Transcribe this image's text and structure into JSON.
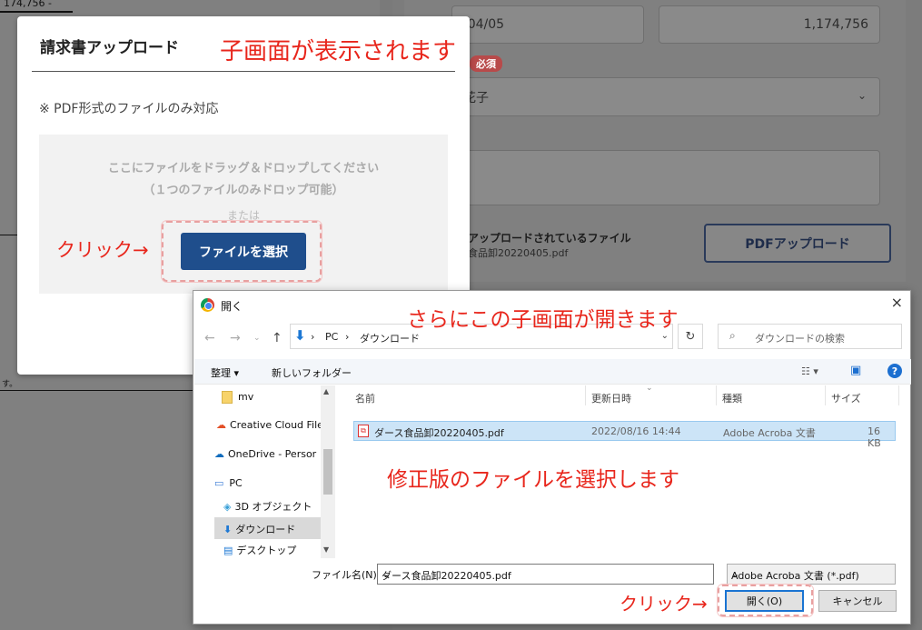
{
  "background": {
    "doc_amount": "174,756 -",
    "doc_snippet": "す。",
    "date_value": "/04/05",
    "amount_value": "1,174,756",
    "required_badge": "必須",
    "name_value": "花子",
    "uploaded_label": "アップロードされているファイル",
    "uploaded_file": "食品卸20220405.pdf",
    "pdf_upload_button": "PDFアップロード"
  },
  "modal": {
    "title": "請求書アップロード",
    "note": "※ PDF形式のファイルのみ対応",
    "drop_line1": "ここにファイルをドラッグ＆ドロップしてください",
    "drop_line2": "（１つのファイルのみドロップ可能）",
    "or_text": "または",
    "select_button": "ファイルを選択"
  },
  "annotations": {
    "child_shown": "子画面が表示されます",
    "click1": "クリック→",
    "dialog_opens": "さらにこの子画面が開きます",
    "select_revised": "修正版のファイルを選択します",
    "click2": "クリック→"
  },
  "dialog": {
    "title": "開く",
    "close": "×",
    "path_pc": "PC",
    "path_folder": "ダウンロード",
    "search_placeholder": "ダウンロードの検索",
    "organize": "整理 ▾",
    "new_folder": "新しいフォルダー",
    "help": "?",
    "tree": [
      {
        "label": "mv",
        "icon": "folder-icon"
      },
      {
        "label": "Creative Cloud File",
        "icon": "creative-cloud-icon"
      },
      {
        "label": "OneDrive - Persor",
        "icon": "onedrive-icon"
      },
      {
        "label": "PC",
        "icon": "pc-icon"
      },
      {
        "label": "3D オブジェクト",
        "icon": "3d-objects-icon"
      },
      {
        "label": "ダウンロード",
        "icon": "download-icon"
      },
      {
        "label": "デスクトップ",
        "icon": "desktop-icon"
      }
    ],
    "columns": {
      "name": "名前",
      "date": "更新日時",
      "type": "種類",
      "size": "サイズ"
    },
    "files": [
      {
        "name": "ダース食品卸20220405.pdf",
        "date": "2022/08/16 14:44",
        "type": "Adobe Acroba 文書",
        "size": "16 KB"
      }
    ],
    "filename_label": "ファイル名(N):",
    "filename_value": "ダース食品卸20220405.pdf",
    "filetype_value": "Adobe Acroba 文書 (*.pdf)",
    "open_button": "開く(O)",
    "cancel_button": "キャンセル"
  }
}
